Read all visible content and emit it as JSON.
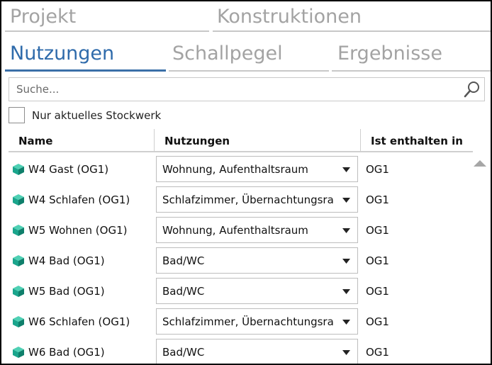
{
  "tabs_top": [
    {
      "label": "Projekt"
    },
    {
      "label": "Konstruktionen"
    }
  ],
  "tabs_main": [
    {
      "label": "Nutzungen",
      "active": true
    },
    {
      "label": "Schallpegel"
    },
    {
      "label": "Ergebnisse"
    }
  ],
  "search": {
    "placeholder": "Suche...",
    "value": "",
    "icon": "search-icon"
  },
  "filter": {
    "label": "Nur aktuelles Stockwerk",
    "checked": false
  },
  "table": {
    "columns": [
      "Name",
      "Nutzungen",
      "Ist enthalten in"
    ],
    "rows": [
      {
        "name": "W4 Gast (OG1)",
        "nutzung": "Wohnung, Aufenthaltsraum",
        "ist": "OG1"
      },
      {
        "name": "W4 Schlafen (OG1)",
        "nutzung": "Schlafzimmer, Übernachtungsra",
        "ist": "OG1"
      },
      {
        "name": "W5 Wohnen (OG1)",
        "nutzung": "Wohnung, Aufenthaltsraum",
        "ist": "OG1"
      },
      {
        "name": "W4 Bad (OG1)",
        "nutzung": "Bad/WC",
        "ist": "OG1"
      },
      {
        "name": "W5 Bad (OG1)",
        "nutzung": "Bad/WC",
        "ist": "OG1"
      },
      {
        "name": "W6 Schlafen (OG1)",
        "nutzung": "Schlafzimmer, Übernachtungsra",
        "ist": "OG1"
      },
      {
        "name": "W6 Bad (OG1)",
        "nutzung": "Bad/WC",
        "ist": "OG1"
      }
    ]
  },
  "colors": {
    "accent": "#2f6bab",
    "inactive_tab": "#a3a3a3",
    "room_icon": "#1aa58c"
  }
}
